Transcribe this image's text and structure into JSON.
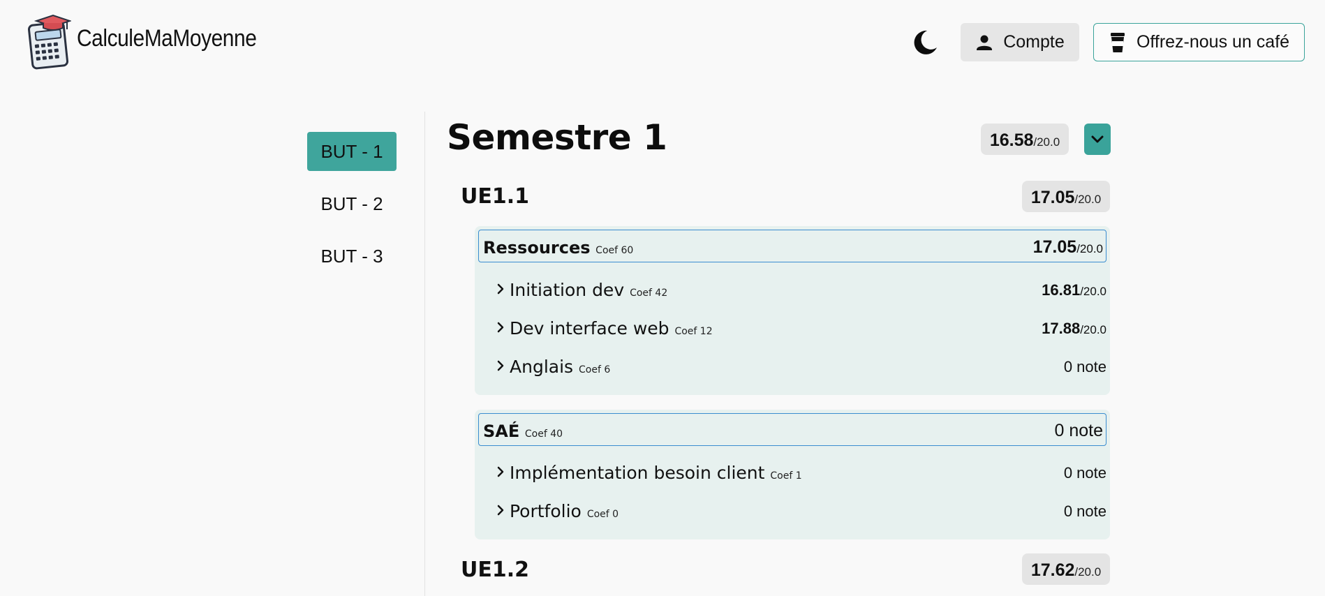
{
  "app": {
    "brand": "CalculeMaMoyenne"
  },
  "header": {
    "account_label": "Compte",
    "coffee_label": "Offrez-nous un café"
  },
  "years": [
    {
      "label": "BUT - 1",
      "active": true
    },
    {
      "label": "BUT - 2",
      "active": false
    },
    {
      "label": "BUT - 3",
      "active": false
    }
  ],
  "semester": {
    "title": "Semestre 1",
    "grade": "16.58",
    "denominator": "/20.0"
  },
  "ue1": {
    "title": "UE1.1",
    "grade": "17.05",
    "denominator": "/20.0",
    "ressources": {
      "label": "Ressources",
      "coef": "Coef 60",
      "grade": "17.05",
      "denominator": "/20.0",
      "items": [
        {
          "name": "Initiation dev",
          "coef": "Coef 42",
          "grade": "16.81",
          "denominator": "/20.0"
        },
        {
          "name": "Dev interface web",
          "coef": "Coef 12",
          "grade": "17.88",
          "denominator": "/20.0"
        },
        {
          "name": "Anglais",
          "coef": "Coef 6",
          "note": "0 note"
        }
      ]
    },
    "sae": {
      "label": "SAÉ",
      "coef": "Coef 40",
      "note": "0 note",
      "items": [
        {
          "name": "Implémentation besoin client",
          "coef": "Coef 1",
          "note": "0 note"
        },
        {
          "name": "Portfolio",
          "coef": "Coef 0",
          "note": "0 note"
        }
      ]
    }
  },
  "ue2": {
    "title": "UE1.2",
    "grade": "17.62",
    "denominator": "/20.0"
  },
  "colors": {
    "accent": "#3fa59c",
    "panel_bg": "#e7f1ef",
    "header_border": "#3a8dd0",
    "pill_bg": "#e4e4e4"
  },
  "icons": {
    "logo": "calculator-graduation-cap-icon",
    "theme": "moon-icon",
    "account": "person-icon",
    "coffee": "coffee-cup-icon",
    "collapse": "chevron-down-icon",
    "row": "chevron-right-icon"
  }
}
